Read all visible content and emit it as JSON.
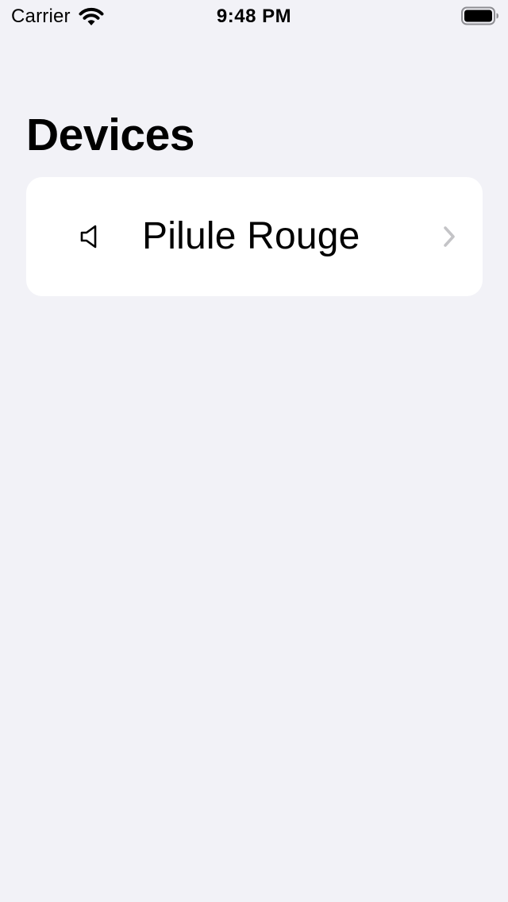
{
  "status_bar": {
    "carrier": "Carrier",
    "time": "9:48 PM",
    "icons": [
      "wifi-icon",
      "battery-icon"
    ]
  },
  "header": {
    "title": "Devices"
  },
  "devices": [
    {
      "name": "Pilule Rouge",
      "icon": "speaker-icon",
      "accessory": "chevron-right-icon"
    }
  ],
  "colors": {
    "background": "#f2f2f7",
    "card": "#ffffff",
    "chevron": "#c4c4c7",
    "text": "#000000"
  }
}
